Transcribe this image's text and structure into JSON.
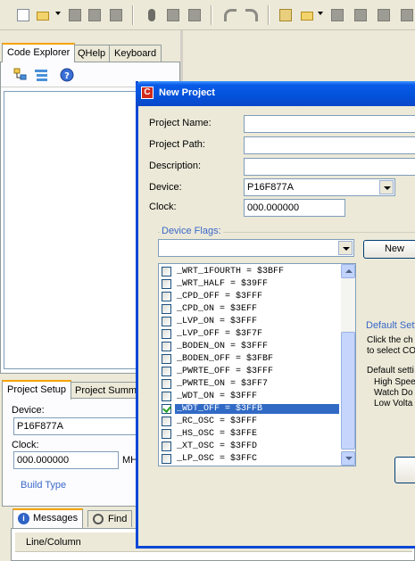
{
  "toolbar": {
    "icons": [
      "new-document-icon",
      "open-folder-icon",
      "save-icon",
      "save-all-icon",
      "close-icon",
      "cut-icon",
      "copy-icon",
      "paste-icon",
      "undo-icon",
      "redo-icon",
      "new-project-icon",
      "open-project-icon",
      "save-project-icon",
      "close-project-icon",
      "compile-icon"
    ]
  },
  "left_tabs": [
    "Code Explorer",
    "QHelp",
    "Keyboard"
  ],
  "explorer_toolbar_icons": [
    "tree-view-icon",
    "list-view-icon",
    "help-icon"
  ],
  "setup_tabs": [
    "Project Setup",
    "Project Summa"
  ],
  "setup": {
    "device_label": "Device:",
    "device_value": "P16F877A",
    "clock_label": "Clock:",
    "clock_value": "000.000000",
    "clock_unit": "MH",
    "build_type": "Build Type"
  },
  "message_tabs": [
    "Messages",
    "Find"
  ],
  "messages": {
    "column_header": "Line/Column"
  },
  "dialog": {
    "title": "New Project",
    "title_icon": "C",
    "project_name_label": "Project Name:",
    "project_name_value": "",
    "project_path_label": "Project Path:",
    "project_path_value": "",
    "description_label": "Description:",
    "description_value": "",
    "device_label": "Device:",
    "device_value": "P16F877A",
    "clock_label": "Clock:",
    "clock_value": "000.000000",
    "device_flags_label": "Device Flags:",
    "device_flags_value": "",
    "new_button": "New",
    "flags": [
      {
        "text": "_WRT_1FOURTH = $3BFF",
        "checked": false,
        "selected": false
      },
      {
        "text": "_WRT_HALF = $39FF",
        "checked": false,
        "selected": false
      },
      {
        "text": "_CPD_OFF = $3FFF",
        "checked": false,
        "selected": false
      },
      {
        "text": "_CPD_ON = $3EFF",
        "checked": false,
        "selected": false
      },
      {
        "text": "_LVP_ON = $3FFF",
        "checked": false,
        "selected": false
      },
      {
        "text": "_LVP_OFF = $3F7F",
        "checked": false,
        "selected": false
      },
      {
        "text": "_BODEN_ON = $3FFF",
        "checked": false,
        "selected": false
      },
      {
        "text": "_BODEN_OFF = $3FBF",
        "checked": false,
        "selected": false
      },
      {
        "text": "_PWRTE_OFF = $3FFF",
        "checked": false,
        "selected": false
      },
      {
        "text": "_PWRTE_ON = $3FF7",
        "checked": false,
        "selected": false
      },
      {
        "text": "_WDT_ON = $3FFF",
        "checked": false,
        "selected": false
      },
      {
        "text": "_WDT_OFF = $3FFB",
        "checked": true,
        "selected": true
      },
      {
        "text": "_RC_OSC = $3FFF",
        "checked": false,
        "selected": false
      },
      {
        "text": "_HS_OSC = $3FFE",
        "checked": false,
        "selected": false
      },
      {
        "text": "_XT_OSC = $3FFD",
        "checked": false,
        "selected": false
      },
      {
        "text": "_LP_OSC = $3FFC",
        "checked": false,
        "selected": false
      }
    ],
    "default_settings_title": "Default Sett",
    "default_hint_1": "Click the ch",
    "default_hint_2": "to select CO",
    "default_settings_label": "Default setti",
    "default_items": [
      "High Spee",
      "Watch Do",
      "Low Volta"
    ]
  },
  "colors": {
    "titlebar": "#0352da",
    "selection": "#316ac5",
    "active_tab_accent": "#f4a300",
    "link": "#3a68c8"
  }
}
